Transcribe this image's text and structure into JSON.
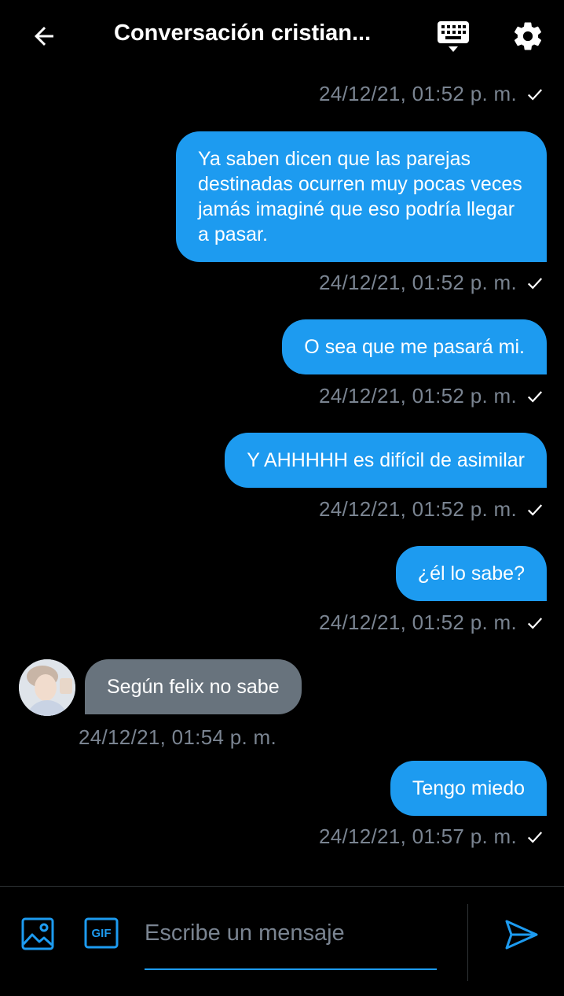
{
  "header": {
    "title": "Conversación cristian...",
    "icons": [
      "back-arrow-icon",
      "keyboard-icon",
      "gear-icon"
    ]
  },
  "messages": [
    {
      "direction": "out",
      "text": "",
      "timestamp": "24/12/21, 01:52 p. m.",
      "read": true
    },
    {
      "direction": "out",
      "text": "Ya saben dicen que las parejas destinadas ocurren muy pocas veces jamás imaginé que eso podría llegar a pasar.",
      "timestamp": "24/12/21, 01:52 p. m.",
      "read": true
    },
    {
      "direction": "out",
      "text": "O sea que me pasará mi.",
      "timestamp": "24/12/21, 01:52 p. m.",
      "read": true
    },
    {
      "direction": "out",
      "text": "Y AHHHHH es difícil de asimilar",
      "timestamp": "24/12/21, 01:52 p. m.",
      "read": true
    },
    {
      "direction": "out",
      "text": "¿él lo sabe?",
      "timestamp": "24/12/21, 01:52 p. m.",
      "read": true
    },
    {
      "direction": "in",
      "text": "Según felix no sabe",
      "timestamp": "24/12/21, 01:54 p. m."
    },
    {
      "direction": "out",
      "text": "Tengo miedo",
      "timestamp": "24/12/21, 01:57 p. m.",
      "read": true
    }
  ],
  "composer": {
    "placeholder": "Escribe un mensaje",
    "icons": [
      "image-icon",
      "gif-icon",
      "send-icon"
    ],
    "gif_label": "GIF"
  },
  "colors": {
    "accent": "#1d9bf0",
    "incoming_bubble": "#68737d",
    "timestamp": "#7a8491",
    "background": "#000000"
  }
}
